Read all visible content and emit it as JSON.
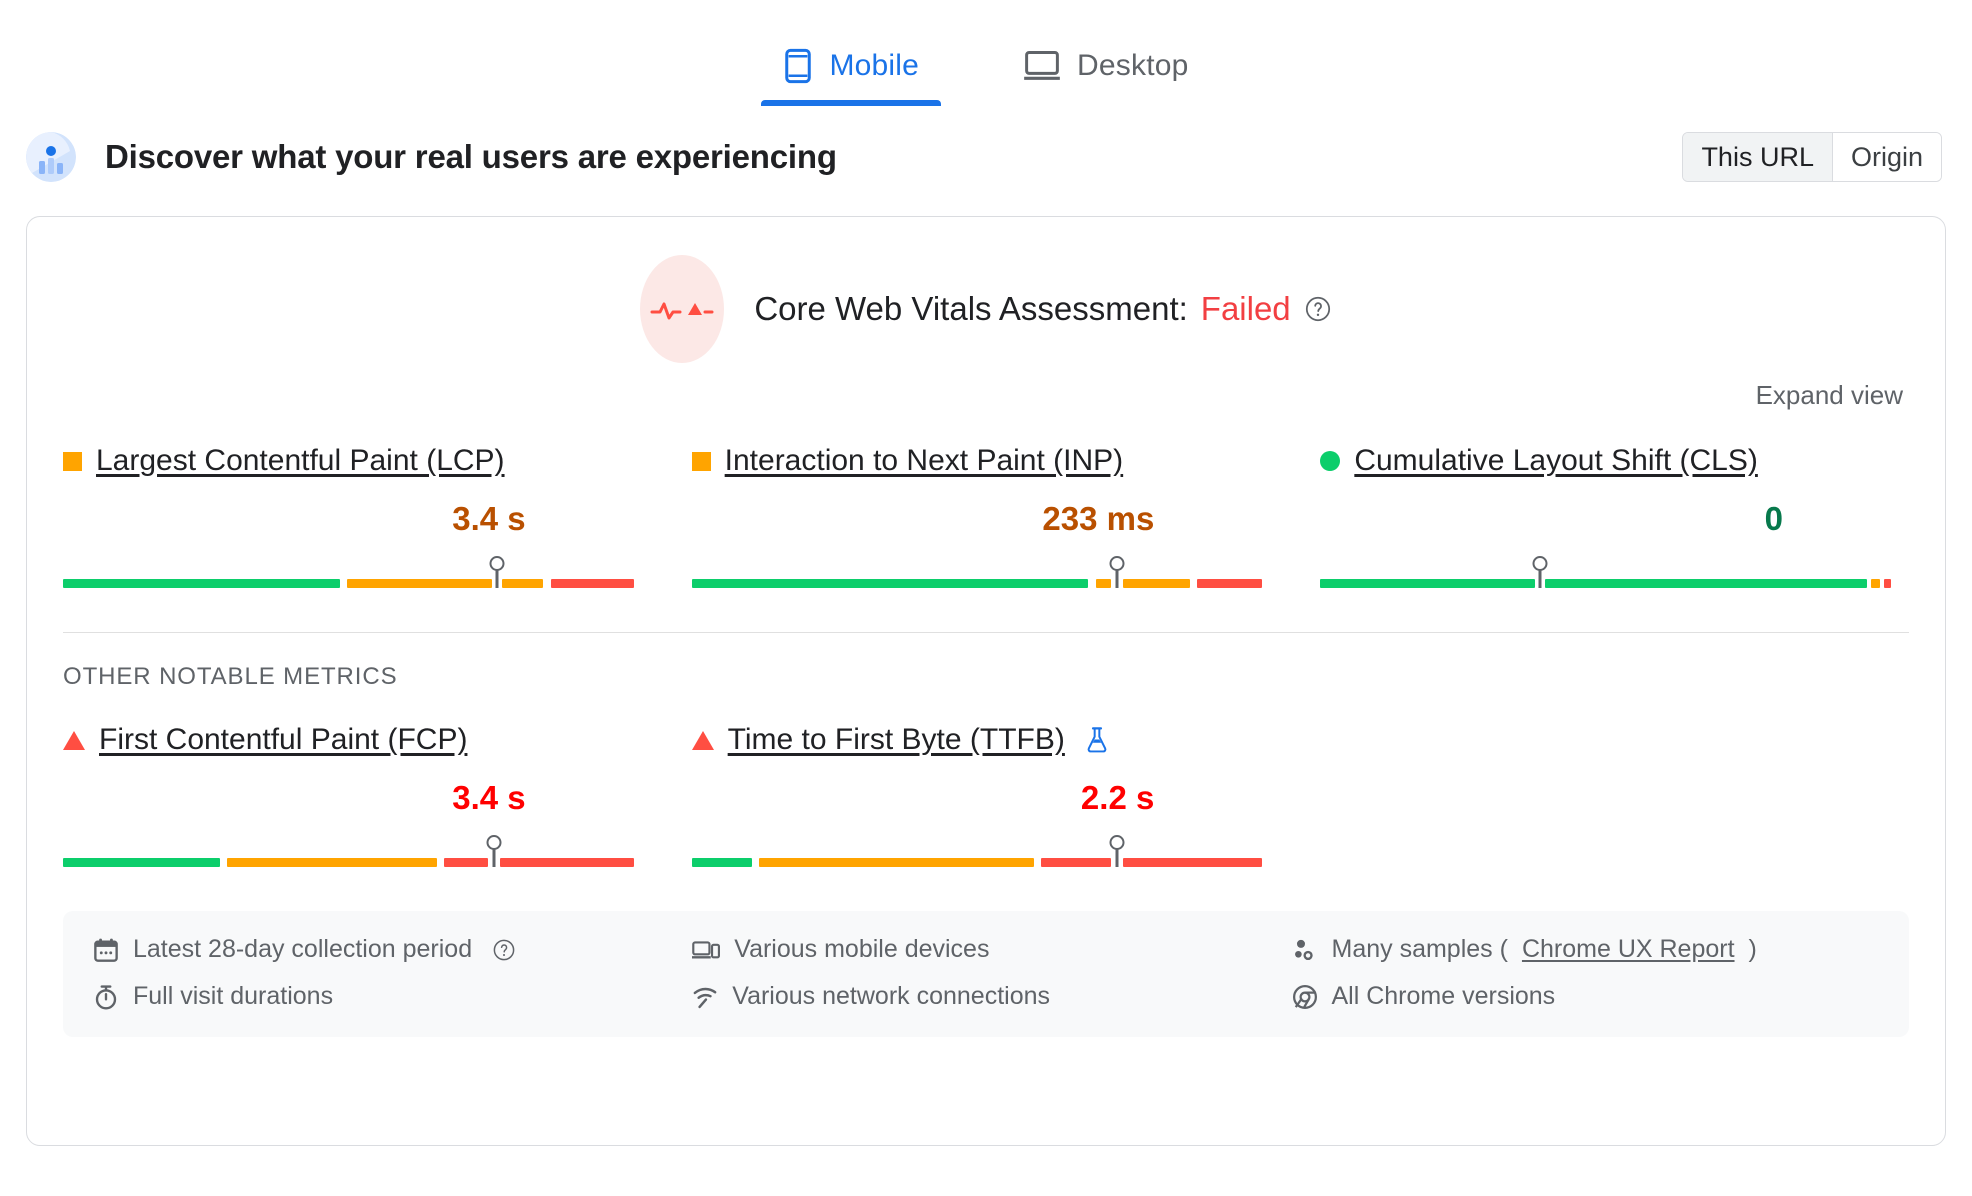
{
  "tabs": [
    {
      "id": "mobile",
      "label": "Mobile",
      "icon": "phone-icon",
      "active": true
    },
    {
      "id": "desktop",
      "label": "Desktop",
      "icon": "monitor-icon",
      "active": false
    }
  ],
  "section": {
    "icon": "field-data-icon",
    "title": "Discover what your real users are experiencing",
    "scope_toggle": [
      {
        "id": "this-url",
        "label": "This URL",
        "selected": true
      },
      {
        "id": "origin",
        "label": "Origin",
        "selected": false
      }
    ]
  },
  "assessment": {
    "icon": "failed-pulse-icon",
    "label": "Core Web Vitals Assessment:",
    "status": "Failed",
    "status_color": "#f23f42",
    "help_icon": "help-circle-icon",
    "expand_label": "Expand view"
  },
  "other_metrics_heading": "OTHER NOTABLE METRICS",
  "colors": {
    "good": "#0cce6b",
    "needs_improvement": "#ffa400",
    "poor": "#ff4e42",
    "blue": "#1a73e8",
    "value_orange": "#b95000",
    "value_green": "#07794c",
    "value_red": "#ff0000"
  },
  "core_web_vitals": [
    {
      "id": "lcp",
      "label": "Largest Contentful Paint (LCP)",
      "status": "needs-improvement",
      "status_shape": "square",
      "value": "3.4 s",
      "value_class": "v-orange",
      "marker_pct": 76,
      "segments": [
        {
          "color": "#0cce6b",
          "start": 0,
          "end": 48.5
        },
        {
          "color": "#ffa400",
          "start": 49.8,
          "end": 75.2
        },
        {
          "color": "#ffa400",
          "start": 77.0,
          "end": 84.2
        },
        {
          "color": "#ff4e42",
          "start": 85.5,
          "end": 100
        }
      ]
    },
    {
      "id": "inp",
      "label": "Interaction to Next Paint (INP)",
      "status": "needs-improvement",
      "status_shape": "square",
      "value": "233 ms",
      "value_class": "v-orange",
      "marker_pct": 74.5,
      "segments": [
        {
          "color": "#0cce6b",
          "start": 0,
          "end": 69.5
        },
        {
          "color": "#ffa400",
          "start": 70.8,
          "end": 73.5
        },
        {
          "color": "#ffa400",
          "start": 75.5,
          "end": 87.3
        },
        {
          "color": "#ff4e42",
          "start": 88.5,
          "end": 100
        }
      ]
    },
    {
      "id": "cls",
      "label": "Cumulative Layout Shift (CLS)",
      "status": "good",
      "status_shape": "circle",
      "value": "0",
      "value_class": "v-green",
      "marker_pct": 38.5,
      "segments": [
        {
          "color": "#0cce6b",
          "start": 0,
          "end": 37.6
        },
        {
          "color": "#0cce6b",
          "start": 39.4,
          "end": 95.8
        },
        {
          "color": "#ffa400",
          "start": 96.5,
          "end": 98.0
        },
        {
          "color": "#ff4e42",
          "start": 98.8,
          "end": 100
        }
      ]
    }
  ],
  "other_metrics": [
    {
      "id": "fcp",
      "label": "First Contentful Paint (FCP)",
      "status": "poor",
      "status_shape": "triangle",
      "value": "3.4 s",
      "value_class": "v-red",
      "marker_pct": 75.5,
      "has_experimental_flag": false,
      "segments": [
        {
          "color": "#0cce6b",
          "start": 0,
          "end": 27.5
        },
        {
          "color": "#ffa400",
          "start": 28.8,
          "end": 65.5
        },
        {
          "color": "#ff4e42",
          "start": 66.8,
          "end": 74.5
        },
        {
          "color": "#ff4e42",
          "start": 76.5,
          "end": 100
        }
      ]
    },
    {
      "id": "ttfb",
      "label": "Time to First Byte (TTFB)",
      "status": "poor",
      "status_shape": "triangle",
      "value": "2.2 s",
      "value_class": "v-red",
      "marker_pct": 74.5,
      "has_experimental_flag": true,
      "experimental_icon": "flask-icon",
      "segments": [
        {
          "color": "#0cce6b",
          "start": 0,
          "end": 10.5
        },
        {
          "color": "#ffa400",
          "start": 11.8,
          "end": 60.0
        },
        {
          "color": "#ff4e42",
          "start": 61.2,
          "end": 73.5
        },
        {
          "color": "#ff4e42",
          "start": 75.5,
          "end": 100
        }
      ]
    }
  ],
  "footer": {
    "columns": [
      {
        "rows": [
          {
            "icon": "calendar-icon",
            "text": "Latest 28-day collection period",
            "help": true
          },
          {
            "icon": "stopwatch-icon",
            "text": "Full visit durations",
            "help": false
          }
        ]
      },
      {
        "rows": [
          {
            "icon": "devices-icon",
            "text": "Various mobile devices",
            "help": false
          },
          {
            "icon": "network-signal-icon",
            "text": "Various network connections",
            "help": false
          }
        ]
      },
      {
        "rows": [
          {
            "icon": "samples-icon",
            "text": "Many samples (",
            "link": "Chrome UX Report",
            "text_after": ")",
            "help": false
          },
          {
            "icon": "chrome-icon",
            "text": "All Chrome versions",
            "help": false
          }
        ]
      }
    ]
  }
}
